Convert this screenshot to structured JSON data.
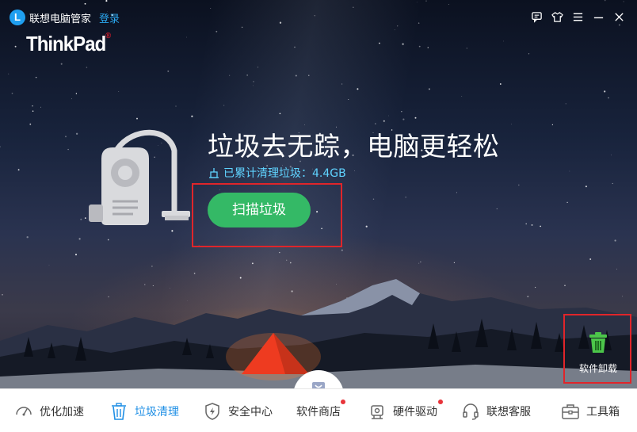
{
  "window": {
    "app_title": "联想电脑管家",
    "login_label": "登录",
    "brand": "ThinkPad",
    "brand_mark": "®",
    "title_icons": [
      "feedback-icon",
      "skin-icon",
      "menu-icon",
      "minimize-icon",
      "close-icon"
    ]
  },
  "hero": {
    "headline": "垃圾去无踪，电脑更轻松",
    "stat_label": "已累计清理垃圾：4.4GB",
    "scan_button": "扫描垃圾",
    "illustration": "vacuum-cleaner-icon"
  },
  "uninstall": {
    "label": "软件卸载",
    "icon": "trash-icon",
    "icon_color": "#4cc64a"
  },
  "nav": {
    "items": [
      {
        "label": "优化加速",
        "icon": "speedometer-icon",
        "active": false,
        "badge": false
      },
      {
        "label": "垃圾清理",
        "icon": "trash-icon",
        "active": true,
        "badge": false
      },
      {
        "label": "安全中心",
        "icon": "shield-icon",
        "active": false,
        "badge": false
      },
      {
        "label": "软件商店",
        "icon": "bag-icon",
        "active": false,
        "badge": true
      },
      {
        "label": "硬件驱动",
        "icon": "chip-icon",
        "active": false,
        "badge": true
      },
      {
        "label": "联想客服",
        "icon": "headset-icon",
        "active": false,
        "badge": false
      },
      {
        "label": "工具箱",
        "icon": "toolbox-icon",
        "active": false,
        "badge": false
      }
    ]
  },
  "colors": {
    "accent": "#1f8fe5",
    "scan_button": "#34b966",
    "stat_text": "#5fd3ff",
    "highlight": "#e0252a",
    "badge": "#e8343a"
  }
}
